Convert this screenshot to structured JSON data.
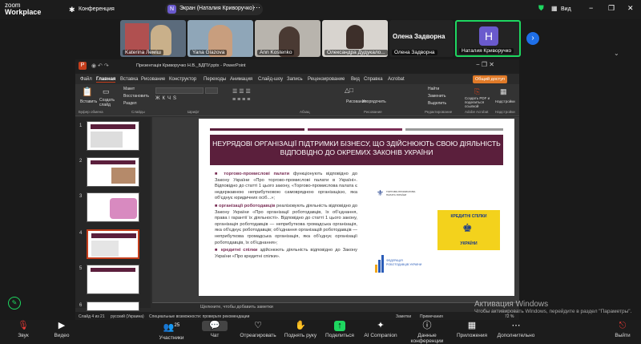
{
  "zoom": {
    "logo_top": "zoom",
    "logo_bottom": "Workplace",
    "conference_label": "Конференция",
    "screen_share_label": "Экран (Наталия Криворучко)",
    "view_label": "Вид",
    "participants_count": "25",
    "presenter_name_big": "Олена Задворна",
    "presenter_initial": "H",
    "thumbs": [
      "Katerina Леміш",
      "Yana Glazova",
      "Ann Kostenko",
      "Олександра Дудукало...",
      "Олена Задворна",
      "Наталия Криворучко"
    ],
    "bottom": {
      "audio": "Звук",
      "video": "Видео",
      "participants": "Участники",
      "chat": "Чат",
      "react": "Отреагировать",
      "raise_hand": "Поднять руку",
      "share": "Поделиться",
      "ai": "AI Companion",
      "conf_data": "Данные конференции",
      "apps": "Приложения",
      "more": "Дополнительно",
      "leave": "Выйти"
    },
    "activation_title": "Активация Windows",
    "activation_sub": "Чтобы активировать Windows, перейдите в раздел \"Параметры\"."
  },
  "ppt": {
    "title": "Презентація Криворучко Н.В._БДПУ.pptx - PowerPoint",
    "tabs": [
      "Файл",
      "Главная",
      "Вставка",
      "Рисование",
      "Конструктор",
      "Переходы",
      "Анимация",
      "Слайд-шоу",
      "Запись",
      "Рецензирование",
      "Вид",
      "Справка",
      "Acrobat"
    ],
    "share_btn": "Общий доступ",
    "ribbon": {
      "paste": "Вставить",
      "create_slide": "Создать слайд",
      "layout": "Макет",
      "reset": "Восстановить",
      "section": "Раздел",
      "find": "Найти",
      "replace": "Заменить",
      "select": "Выделить",
      "create_pdf": "Создать PDF и поделиться ссылкой",
      "addins": "Надстройки",
      "drawing": "Рисование",
      "arrange": "Упорядочить",
      "group_clipboard": "Буфер обмена",
      "group_slides": "Слайды",
      "group_font": "Шрифт",
      "group_para": "Абзац",
      "group_draw": "Рисование",
      "group_edit": "Редактирование",
      "group_acrobat": "Adobe Acrobat",
      "group_addins": "Надстройки"
    },
    "notes_placeholder": "Щелкните, чтобы добавить заметки",
    "status": {
      "slide": "Слайд 4 из 21",
      "lang": "русский (Украина)",
      "access": "Специальные возможности: проверьте рекомендации",
      "notes": "Заметки",
      "comments": "Примечания",
      "zoom": "72 %"
    },
    "slide_numbers": [
      "1",
      "2",
      "3",
      "4",
      "5",
      "6"
    ]
  },
  "slide": {
    "title": "НЕУРЯДОВІ ОРГАНІЗАЦІЇ ПІДТРИМКИ БІЗНЕСУ, ЩО ЗДІЙСНЮЮТЬ СВОЮ ДІЯЛЬНІСТЬ ВІДПОВІДНО ДО ОКРЕМИХ ЗАКОНІВ УКРАЇНИ",
    "b1_head": "торгово-промислові палати",
    "b1_text": "функціонують відповідно до Закону України «Про торгово-промислові палати в Україні». Відповідно до статті 1 цього закону, «Торгово-промислова палата є недержавною неприбутковою самоврядною організацією, яка об'єднує юридичних осіб...»;",
    "b2_head": "організації роботодавців",
    "b2_text": "реалізовують діяльність відповідно до Закону України «Про організації роботодавців, їх об'єднання, права і гарантії їх діяльності». Відповідно до статті 1 цього закону, організація роботодавців — неприбуткова громадська організація, яка об'єднує роботодавців; об'єднання організацій роботодавців — неприбуткова громадська організація, яка об'єднує організації роботодавців, їх об'єднання»;",
    "b3_head": "кредитні спілки",
    "b3_text": "здійснюють діяльність відповідно до Закону України «Про кредитні спілки».",
    "logo1": "ТОРГОВО-ПРОМИСЛОВА ПАЛАТА УКРАЇНИ",
    "logo2_top": "КРЕДИТНІ СПІЛКИ",
    "logo2_bottom": "УКРАЇНИ",
    "logo3": "ФЕДЕРАЦІЯ РОБОТОДАВЦІВ УКРАЇНИ"
  },
  "colors": {
    "accent_maroon": "#5b1f3c",
    "zoom_green": "#1ed760",
    "ppt_red": "#c43e1c",
    "share_orange": "#e07a28"
  }
}
